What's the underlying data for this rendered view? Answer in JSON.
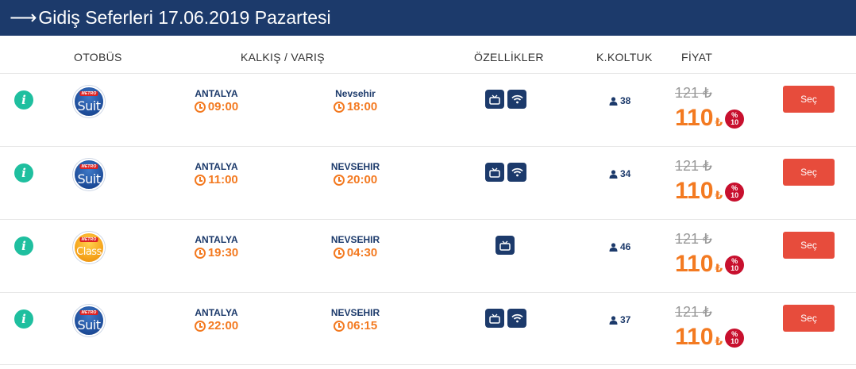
{
  "header": {
    "arrow": "⟶",
    "title": "Gidiş Seferleri 17.06.2019 Pazartesi"
  },
  "columns": {
    "bus": "OTOBÜS",
    "route": "KALKIŞ / VARIŞ",
    "features": "ÖZELLİKLER",
    "seats": "K.KOLTUK",
    "price": "FİYAT"
  },
  "brand_text": "METRO",
  "currency": "₺",
  "select_label": "Seç",
  "trips": [
    {
      "logo": "Suit",
      "logo_type": "suit",
      "dep_city": "ANTALYA",
      "dep_time": "09:00",
      "arr_city": "Nevsehir",
      "arr_time": "18:00",
      "features": [
        "tv-icon",
        "wifi-icon"
      ],
      "seats": "38",
      "old_price": "121",
      "new_price": "110",
      "discount_pct": "%",
      "discount_val": "10"
    },
    {
      "logo": "Suit",
      "logo_type": "suit",
      "dep_city": "ANTALYA",
      "dep_time": "11:00",
      "arr_city": "NEVSEHIR",
      "arr_time": "20:00",
      "features": [
        "tv-icon",
        "wifi-icon"
      ],
      "seats": "34",
      "old_price": "121",
      "new_price": "110",
      "discount_pct": "%",
      "discount_val": "10"
    },
    {
      "logo": "Class",
      "logo_type": "class",
      "dep_city": "ANTALYA",
      "dep_time": "19:30",
      "arr_city": "NEVSEHIR",
      "arr_time": "04:30",
      "features": [
        "tv-icon"
      ],
      "seats": "46",
      "old_price": "121",
      "new_price": "110",
      "discount_pct": "%",
      "discount_val": "10"
    },
    {
      "logo": "Suit",
      "logo_type": "suit",
      "dep_city": "ANTALYA",
      "dep_time": "22:00",
      "arr_city": "NEVSEHIR",
      "arr_time": "06:15",
      "features": [
        "tv-icon",
        "wifi-icon"
      ],
      "seats": "37",
      "old_price": "121",
      "new_price": "110",
      "discount_pct": "%",
      "discount_val": "10"
    }
  ],
  "colors": {
    "header_bg": "#1c3a6b",
    "accent_orange": "#f37a21",
    "button_red": "#e74c3c",
    "info_green": "#1fbf9f"
  }
}
